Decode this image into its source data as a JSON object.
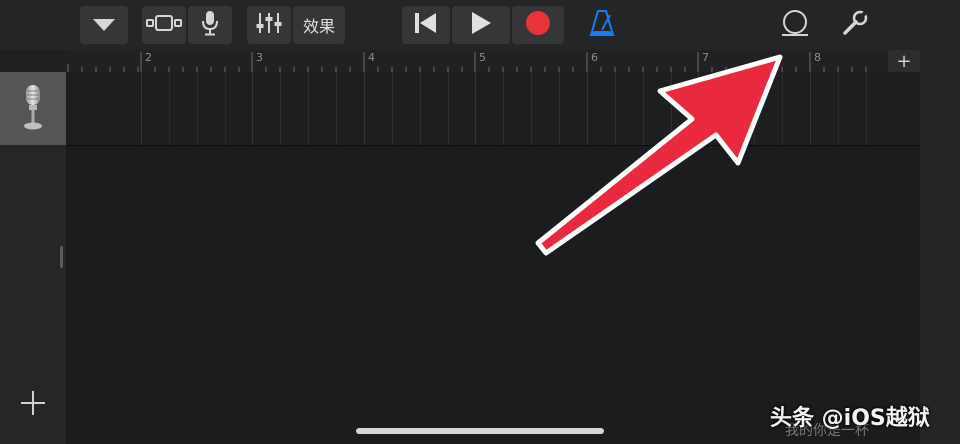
{
  "toolbar": {
    "effects_label": "效果"
  },
  "ruler": {
    "bar_labels": [
      "2",
      "3",
      "4",
      "5",
      "6",
      "7",
      "8"
    ],
    "add_section_label": "+"
  },
  "tracks": [
    {
      "instrument_icon": "microphone-icon"
    }
  ],
  "watermark": {
    "text": "头条 @iOS越狱",
    "subtext": "我的你是一杯"
  },
  "colors": {
    "record": "#e8333a",
    "metronome": "#1b7bf0",
    "annotation_arrow": "#e8293e"
  }
}
